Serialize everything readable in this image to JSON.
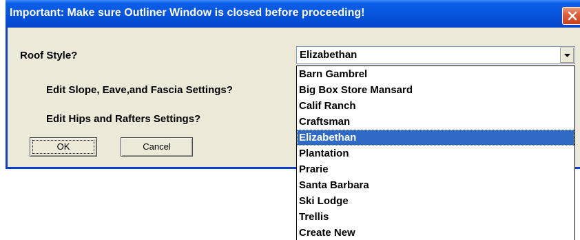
{
  "dialog": {
    "title": "Important:  Make sure Outliner Window is closed before proceeding!",
    "roof_style_label": "Roof Style?",
    "edit_slope_label": "Edit  Slope, Eave,and Fascia Settings?",
    "edit_hips_label": "Edit  Hips and Rafters Settings?",
    "ok_label": "OK",
    "cancel_label": "Cancel"
  },
  "roof_style": {
    "selected": "Elizabethan",
    "options": [
      "Barn Gambrel",
      "Big Box Store Mansard",
      "Calif Ranch",
      "Craftsman",
      "Elizabethan",
      "Plantation",
      "Prarie",
      "Santa Barbara",
      "Ski Lodge",
      "Trellis",
      "Create  New"
    ],
    "highlighted_index": 4
  },
  "colors": {
    "title_bar": "#0753dc",
    "dialog_bg": "#ece9d8",
    "selection": "#316ac5",
    "close_button": "#e0603a"
  },
  "icons": {
    "close": "close-icon",
    "dropdown": "chevron-down-icon"
  }
}
